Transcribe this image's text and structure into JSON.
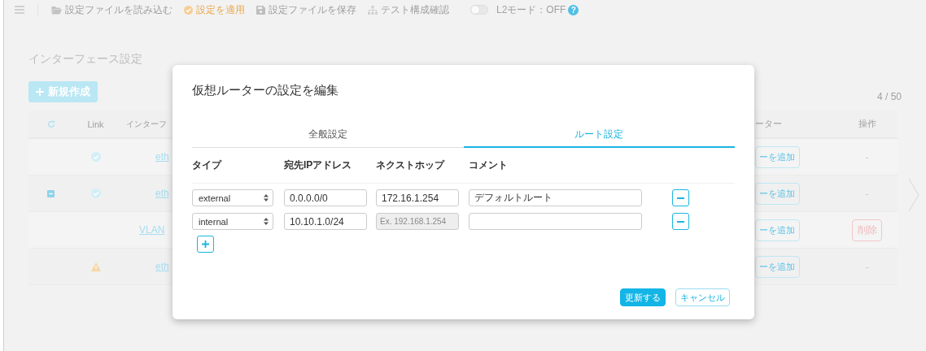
{
  "toolbar": {
    "items": [
      {
        "label": "設定ファイルを読み込む",
        "active": false
      },
      {
        "label": "設定を適用",
        "active": true
      },
      {
        "label": "設定ファイルを保存",
        "active": false
      },
      {
        "label": "テスト構成確認",
        "active": false
      }
    ],
    "l2_mode": {
      "label": "L2モード：OFF",
      "on": false
    },
    "help": "?"
  },
  "page": {
    "title": "インターフェース設定",
    "new_button": "新規作成",
    "pager": "4 / 50",
    "table": {
      "columns": [
        "Link",
        "インターフ",
        "ーター",
        "操作"
      ],
      "rows": [
        {
          "expanded": false,
          "link": {
            "kind": "ok"
          },
          "name": "eth",
          "router_button": "ーを追加",
          "action": {
            "kind": "text",
            "label": "-"
          }
        },
        {
          "expanded": true,
          "link": {
            "kind": "ok"
          },
          "name": "eth",
          "router_button": "ーを追加",
          "action": {
            "kind": "text",
            "label": "-"
          }
        },
        {
          "expanded": false,
          "name": "VLAN",
          "router_button": "ーを追加",
          "action": {
            "kind": "button",
            "label": "削除"
          }
        },
        {
          "expanded": false,
          "link": {
            "kind": "warning"
          },
          "name": "eth",
          "router_button": "ーを追加",
          "action": {
            "kind": "text",
            "label": "-"
          }
        }
      ]
    }
  },
  "modal": {
    "title": "仮想ルーターの設定を編集",
    "tabs": [
      {
        "label": "全般設定",
        "selected": false
      },
      {
        "label": "ルート設定",
        "selected": true
      }
    ],
    "columns": [
      "タイプ",
      "宛先IPアドレス",
      "ネクストホップ",
      "コメント"
    ],
    "routes": [
      {
        "type": "external",
        "destination": "0.0.0.0/0",
        "next_hop": {
          "value": "172.16.1.254",
          "disabled": false
        },
        "comment": "デフォルトルート"
      },
      {
        "type": "internal",
        "destination": "10.10.1.0/24",
        "next_hop": {
          "placeholder": "Ex. 192.168.1.254",
          "disabled": true
        }
      }
    ],
    "buttons": [
      {
        "label": "更新する",
        "kind": "primary"
      },
      {
        "label": "キャンセル",
        "kind": "secondary"
      }
    ]
  }
}
